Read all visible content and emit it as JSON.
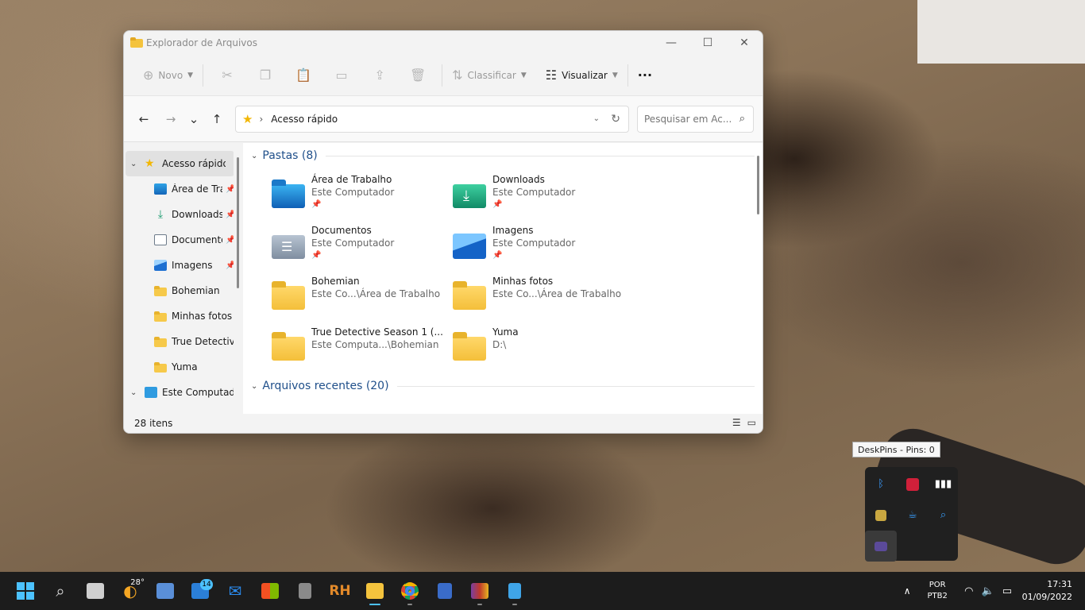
{
  "window": {
    "title": "Explorador de Arquivos",
    "controls": {
      "minimize": "—",
      "maximize": "☐",
      "close": "✕"
    }
  },
  "toolbar": {
    "new_label": "Novo",
    "sort_label": "Classificar",
    "view_label": "Visualizar",
    "more_label": "···"
  },
  "navigation": {
    "back": "←",
    "forward": "→",
    "recent": "⌄",
    "up": "↑",
    "address": "Acesso rápido",
    "search_placeholder": "Pesquisar em Ac..."
  },
  "sidebar": {
    "quick_access": "Acesso rápido",
    "items": [
      {
        "label": "Área de Trab",
        "icon": "desktop-icon",
        "pinned": true
      },
      {
        "label": "Downloads",
        "icon": "download-icon",
        "pinned": true
      },
      {
        "label": "Documento",
        "icon": "document-icon",
        "pinned": true
      },
      {
        "label": "Imagens",
        "icon": "pictures-icon",
        "pinned": true
      },
      {
        "label": "Bohemian",
        "icon": "folder-icon",
        "pinned": false
      },
      {
        "label": "Minhas fotos",
        "icon": "folder-icon",
        "pinned": false
      },
      {
        "label": "True Detective S",
        "icon": "folder-icon",
        "pinned": false
      },
      {
        "label": "Yuma",
        "icon": "folder-icon",
        "pinned": false
      }
    ],
    "this_pc": "Este Computado"
  },
  "main": {
    "folders_header": "Pastas (8)",
    "recent_header": "Arquivos recentes (20)",
    "folders": [
      {
        "name": "Área de Trabalho",
        "location": "Este Computador",
        "icon": "desktop-folder-icon",
        "pinned": true
      },
      {
        "name": "Downloads",
        "location": "Este Computador",
        "icon": "downloads-folder-icon",
        "pinned": true
      },
      {
        "name": "Documentos",
        "location": "Este Computador",
        "icon": "documents-folder-icon",
        "pinned": true
      },
      {
        "name": "Imagens",
        "location": "Este Computador",
        "icon": "pictures-folder-icon",
        "pinned": true
      },
      {
        "name": "Bohemian",
        "location": "Este Co...\\Área de Trabalho",
        "icon": "folder-icon",
        "pinned": false
      },
      {
        "name": "Minhas fotos",
        "location": "Este Co...\\Área de Trabalho",
        "icon": "folder-icon",
        "pinned": false
      },
      {
        "name": "True Detective Season 1  (...",
        "location": "Este Computa...\\Bohemian",
        "icon": "folder-icon",
        "pinned": false
      },
      {
        "name": "Yuma",
        "location": "D:\\",
        "icon": "folder-icon",
        "pinned": false
      }
    ]
  },
  "status": {
    "items_count": "28 itens"
  },
  "tooltip": "DeskPins - Pins: 0",
  "taskbar": {
    "weather_temp": "28°",
    "mail_badge": "14",
    "language_top": "POR",
    "language_bottom": "PTB2",
    "time": "17:31",
    "date": "01/09/2022",
    "accent": "#4cc2ff"
  }
}
